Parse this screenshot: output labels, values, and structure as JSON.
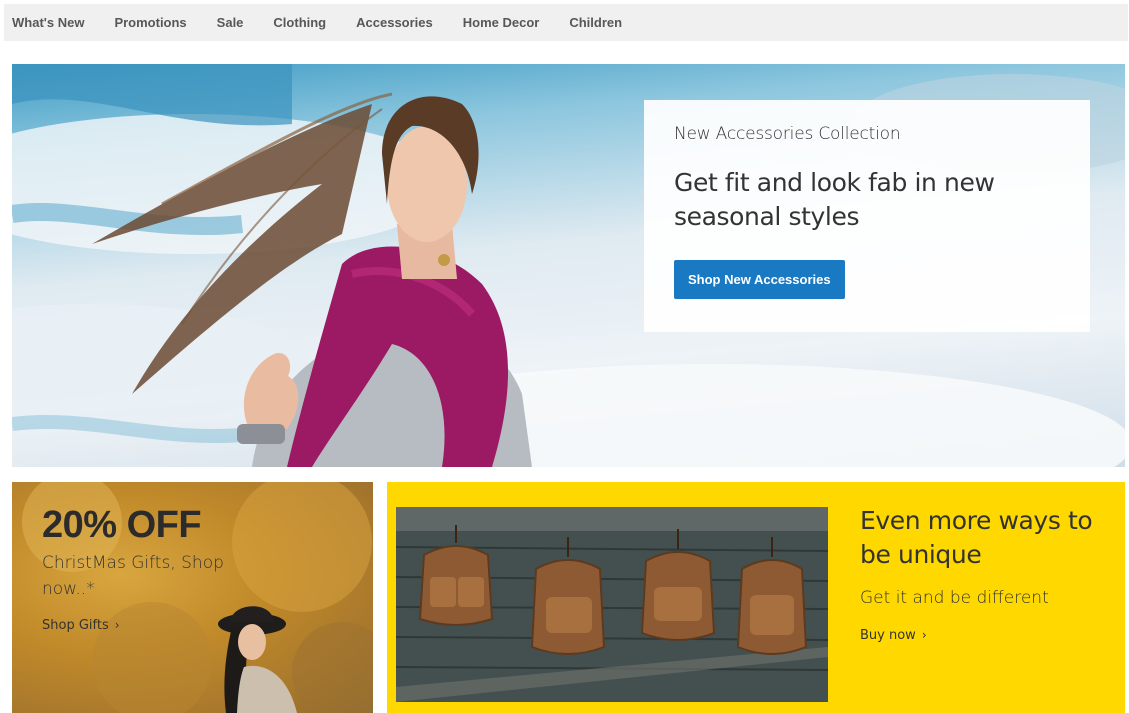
{
  "nav": {
    "items": [
      "What's New",
      "Promotions",
      "Sale",
      "Clothing",
      "Accessories",
      "Home Decor",
      "Children"
    ]
  },
  "hero": {
    "eyebrow": "New Accessories Collection",
    "heading": "Get fit and look fab in new seasonal styles",
    "button_label": "Shop New Accessories"
  },
  "promo_gifts": {
    "discount": "20% OFF",
    "subtitle": "ChristMas Gifts, Shop now..*",
    "link_label": "Shop Gifts"
  },
  "promo_unique": {
    "title": "Even more ways to be unique",
    "subtitle": "Get it and be different",
    "link_label": "Buy now"
  },
  "icons": {
    "chevron": "chevron-right-icon"
  },
  "colors": {
    "accent_button": "#1979c3",
    "promo_yellow": "#ffd800",
    "nav_bg": "#f0f0f0"
  }
}
